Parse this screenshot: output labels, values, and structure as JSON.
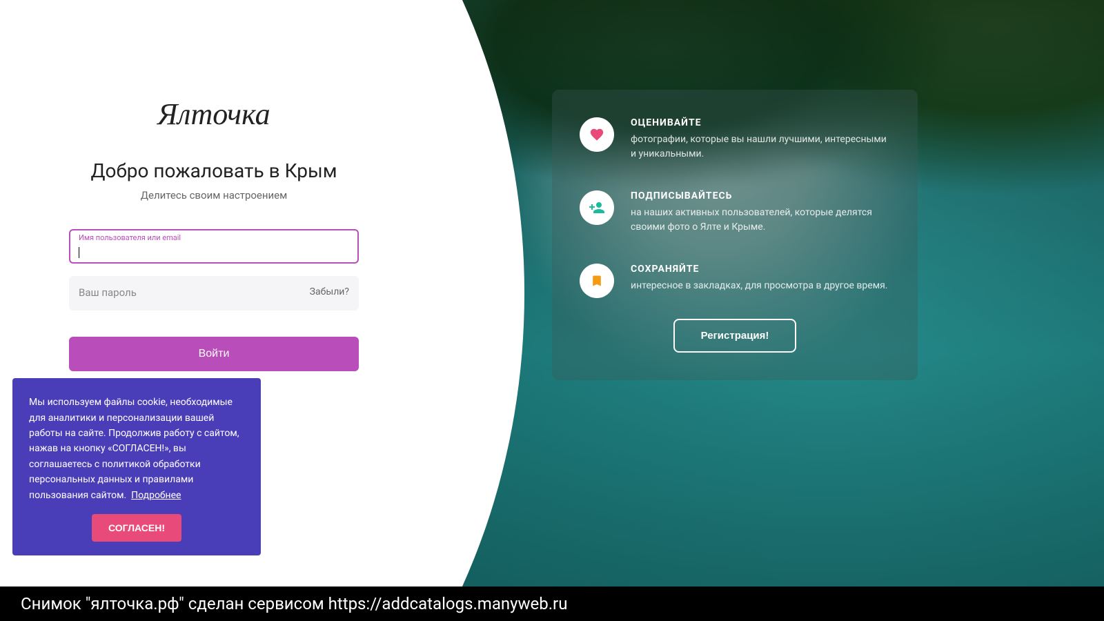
{
  "brand": {
    "logo_text": "Ялточка"
  },
  "hero": {
    "title": "Добро пожаловать в Крым",
    "subtitle": "Делитесь своим настроением"
  },
  "login_form": {
    "username_label": "Имя пользователя или email",
    "username_value": "",
    "password_placeholder": "Ваш пароль",
    "password_value": "",
    "forgot_label": "Забыли?",
    "submit_label": "Войти"
  },
  "features": {
    "items": [
      {
        "icon": "heart-icon",
        "title": "ОЦЕНИВАЙТЕ",
        "desc": "фотографии, которые вы нашли лучшими, интересными и уникальными."
      },
      {
        "icon": "person-add-icon",
        "title": "ПОДПИСЫВАЙТЕСЬ",
        "desc": "на наших активных пользователей, которые делятся своими фото о Ялте и Крыме."
      },
      {
        "icon": "bookmark-icon",
        "title": "СОХРАНЯЙТЕ",
        "desc": "интересное в закладках, для просмотра в другое время."
      }
    ],
    "register_label": "Регистрация!"
  },
  "cookie": {
    "text": "Мы используем файлы cookie, необходимые для аналитики и персонализации вашей работы на сайте. Продолжив работу с сайтом, нажав на кнопку «СОГЛАСЕН!», вы соглашаетесь с политикой обработки персональных данных и правилами пользования сайтом.",
    "more_label": "Подробнее",
    "accept_label": "СОГЛАСЕН!"
  },
  "footer": {
    "caption": "Снимок \"ялточка.рф\" сделан сервисом https://addcatalogs.manyweb.ru"
  }
}
